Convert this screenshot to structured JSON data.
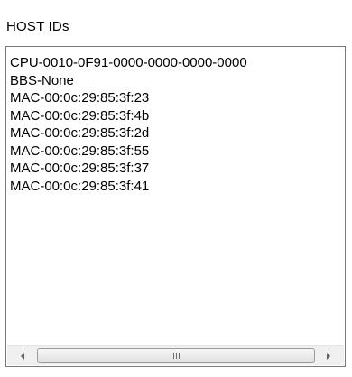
{
  "group": {
    "label": "HOST IDs"
  },
  "host_ids": [
    "CPU-0010-0F91-0000-0000-0000-0000",
    "BBS-None",
    "MAC-00:0c:29:85:3f:23",
    "MAC-00:0c:29:85:3f:4b",
    "MAC-00:0c:29:85:3f:2d",
    "MAC-00:0c:29:85:3f:55",
    "MAC-00:0c:29:85:3f:37",
    "MAC-00:0c:29:85:3f:41"
  ],
  "scrollbar": {
    "left_icon": "scroll-left-arrow-icon",
    "right_icon": "scroll-right-arrow-icon",
    "thumb_icon": "grip-icon"
  }
}
